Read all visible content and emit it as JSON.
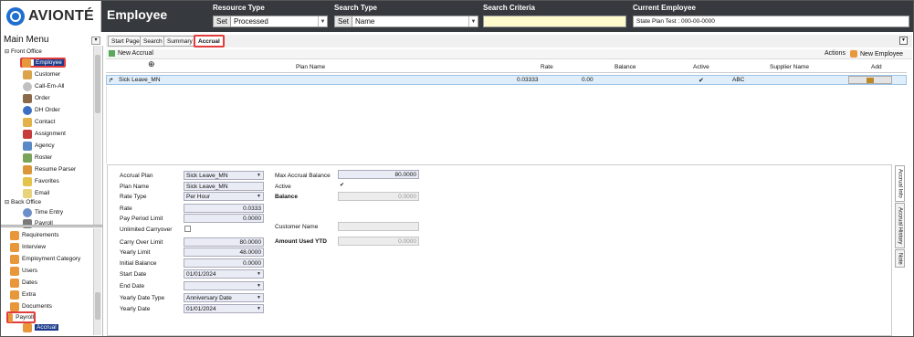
{
  "app": {
    "logo_text": "AVIONTÉ",
    "page_title": "Employee"
  },
  "header": {
    "resource_type": {
      "label": "Resource Type",
      "set": "Set",
      "value": "Processed"
    },
    "search_type": {
      "label": "Search Type",
      "set": "Set",
      "value": "Name"
    },
    "search_criteria": {
      "label": "Search Criteria",
      "value": ""
    },
    "current_employee": {
      "label": "Current Employee",
      "value": "State Plan Test : 000-00-0000"
    }
  },
  "sidebar": {
    "title": "Main Menu",
    "front_office": "Front Office",
    "front_items": [
      "Employee",
      "Customer",
      "Call-Em-All",
      "Order",
      "DH Order",
      "Contact",
      "Assignment",
      "Agency",
      "Roster",
      "Resume Parser",
      "Favorites",
      "Email"
    ],
    "back_office": "Back Office",
    "back_items": [
      "Time Entry",
      "Payroll"
    ],
    "lower_items": [
      "Requirements",
      "Interview",
      "Employment Category",
      "Users",
      "Dates",
      "Extra",
      "Documents"
    ],
    "payroll": "Payroll",
    "accrual": "Accrual"
  },
  "tabs": [
    "Start Page",
    "Search",
    "Summary",
    "Accrual"
  ],
  "toolbar": {
    "new_accrual": "New Accrual",
    "actions": "Actions",
    "new_employee": "New Employee"
  },
  "grid": {
    "headers": [
      "Plan Name",
      "Rate",
      "Balance",
      "Active",
      "Supplier Name",
      "Add"
    ],
    "row": {
      "plan_name": "Sick Leave_MN",
      "rate": "0.03333",
      "balance": "0.00",
      "supplier": "ABC"
    }
  },
  "form": {
    "accrual_plan": {
      "label": "Accrual Plan",
      "value": "Sick Leave_MN"
    },
    "plan_name": {
      "label": "Plan Name",
      "value": "Sick Leave_MN"
    },
    "rate_type": {
      "label": "Rate Type",
      "value": "Per Hour"
    },
    "rate": {
      "label": "Rate",
      "value": "0.0333"
    },
    "pay_period_limit": {
      "label": "Pay Period Limit",
      "value": "0.0000"
    },
    "unlimited_carryover": {
      "label": "Unlimited Carryover"
    },
    "carry_over_limit": {
      "label": "Carry Over Limit",
      "value": "80.0000"
    },
    "yearly_limit": {
      "label": "Yearly Limit",
      "value": "48.0000"
    },
    "initial_balance": {
      "label": "Initial Balance",
      "value": "0.0000"
    },
    "start_date": {
      "label": "Start Date",
      "value": "01/01/2024"
    },
    "end_date": {
      "label": "End Date",
      "value": ""
    },
    "yearly_date_type": {
      "label": "Yearly Date Type",
      "value": "Anniversary Date"
    },
    "yearly_date": {
      "label": "Yearly Date",
      "value": "01/01/2024"
    },
    "max_accrual_balance": {
      "label": "Max Accrual Balance",
      "value": "80.0000"
    },
    "active": {
      "label": "Active"
    },
    "balance": {
      "label": "Balance",
      "value": "0.0000"
    },
    "customer_name": {
      "label": "Customer Name",
      "value": ""
    },
    "amount_used_ytd": {
      "label": "Amount Used YTD",
      "value": "0.0000"
    }
  },
  "side_tabs": [
    "Accrual Info",
    "Accrual History",
    "Note"
  ]
}
